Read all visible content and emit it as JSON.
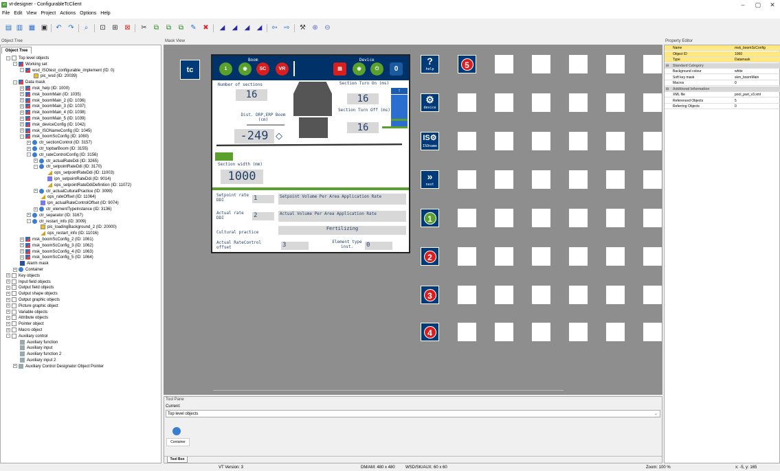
{
  "window": {
    "title": "vt-designer - ConfigurableTcClient",
    "min": "–",
    "max": "▢",
    "close": "✕"
  },
  "menu": [
    "File",
    "Edit",
    "View",
    "Project",
    "Actions",
    "Options",
    "Help"
  ],
  "panels": {
    "object_tree": "Object Tree",
    "object_tree_tab": "Object Tree",
    "mask_view": "Mask View",
    "property_editor": "Property Editor",
    "tool_pane": "Tool Pane",
    "tool_box_tab": "Tool Box"
  },
  "tree": [
    {
      "label": "Top level objects",
      "d": 0,
      "ic": "folder",
      "exp": "-"
    },
    {
      "label": "Working set",
      "d": 1,
      "ic": "mask",
      "exp": "-"
    },
    {
      "label": "wsd_ISOtest_configurable_implement (ID: 0)",
      "d": 2,
      "ic": "mask",
      "exp": "-"
    },
    {
      "label": "pic_wsd (ID: 20039)",
      "d": 3,
      "ic": "pic",
      "exp": ""
    },
    {
      "label": "Data mask",
      "d": 1,
      "ic": "mask",
      "exp": "-"
    },
    {
      "label": "msk_help (ID: 1000)",
      "d": 2,
      "ic": "mask",
      "exp": "+"
    },
    {
      "label": "msk_boomMain (ID: 1035)",
      "d": 2,
      "ic": "mask",
      "exp": "+"
    },
    {
      "label": "msk_boomMain_2 (ID: 1036)",
      "d": 2,
      "ic": "mask",
      "exp": "+"
    },
    {
      "label": "msk_boomMain_3 (ID: 1037)",
      "d": 2,
      "ic": "mask",
      "exp": "+"
    },
    {
      "label": "msk_boomMain_4 (ID: 1038)",
      "d": 2,
      "ic": "mask",
      "exp": "+"
    },
    {
      "label": "msk_boomMain_5 (ID: 1039)",
      "d": 2,
      "ic": "mask",
      "exp": "+"
    },
    {
      "label": "msk_deviceConfig (ID: 1042)",
      "d": 2,
      "ic": "mask",
      "exp": "+"
    },
    {
      "label": "msk_ISONameConfig (ID: 1045)",
      "d": 2,
      "ic": "mask",
      "exp": "+"
    },
    {
      "label": "msk_boomScConfig (ID: 1060)",
      "d": 2,
      "ic": "mask",
      "exp": "-"
    },
    {
      "label": "ctr_sectionControl (ID: 3157)",
      "d": 3,
      "ic": "ctr",
      "exp": "+"
    },
    {
      "label": "ctr_topbarBoom (ID: 3155)",
      "d": 3,
      "ic": "ctr",
      "exp": "+"
    },
    {
      "label": "ctr_rateControlConfig (ID: 3156)",
      "d": 3,
      "ic": "ctr",
      "exp": "-"
    },
    {
      "label": "ctr_actualRateDdi (ID: 3265)",
      "d": 4,
      "ic": "ctr",
      "exp": "+"
    },
    {
      "label": "ctr_setpointRateDdi (ID: 3170)",
      "d": 4,
      "ic": "ctr",
      "exp": "-"
    },
    {
      "label": "ops_setpointRateDdi (ID: 11003)",
      "d": 5,
      "ic": "ops",
      "exp": ""
    },
    {
      "label": "ipn_setpointRateDdi (ID: 9014)",
      "d": 5,
      "ic": "ipn",
      "exp": ""
    },
    {
      "label": "ops_setpointRateDdiDefinition (ID: 11072)",
      "d": 5,
      "ic": "ops",
      "exp": ""
    },
    {
      "label": "ctr_actualCulturalPractice (ID: 3099)",
      "d": 4,
      "ic": "ctr",
      "exp": "+"
    },
    {
      "label": "ops_rateOffset (ID: 11064)",
      "d": 4,
      "ic": "ops",
      "exp": ""
    },
    {
      "label": "ipn_actualRateControlOffset (ID: 9074)",
      "d": 4,
      "ic": "ipn",
      "exp": ""
    },
    {
      "label": "ctr_elementTypeInstance (ID: 3136)",
      "d": 4,
      "ic": "ctr",
      "exp": "+"
    },
    {
      "label": "ctr_separator (ID: 3167)",
      "d": 3,
      "ic": "ctr",
      "exp": "+"
    },
    {
      "label": "ctr_restart_info (ID: 3009)",
      "d": 3,
      "ic": "ctr",
      "exp": "-"
    },
    {
      "label": "pic_loadingBackground_2 (ID: 20000)",
      "d": 4,
      "ic": "pic",
      "exp": ""
    },
    {
      "label": "ops_restart_info (ID: 11016)",
      "d": 4,
      "ic": "ops",
      "exp": ""
    },
    {
      "label": "msk_boomScConfig_2 (ID: 1061)",
      "d": 2,
      "ic": "mask",
      "exp": "+"
    },
    {
      "label": "msk_boomScConfig_3 (ID: 1062)",
      "d": 2,
      "ic": "mask",
      "exp": "+"
    },
    {
      "label": "msk_boomScConfig_4 (ID: 1063)",
      "d": 2,
      "ic": "mask",
      "exp": "+"
    },
    {
      "label": "msk_boomScConfig_5 (ID: 1064)",
      "d": 2,
      "ic": "mask",
      "exp": "+"
    },
    {
      "label": "Alarm mask",
      "d": 1,
      "ic": "alarm",
      "exp": ""
    },
    {
      "label": "Container",
      "d": 1,
      "ic": "ctr",
      "exp": "+"
    },
    {
      "label": "Key objects",
      "d": 0,
      "ic": "folder",
      "exp": "+"
    },
    {
      "label": "Input field objects",
      "d": 0,
      "ic": "folder",
      "exp": "+"
    },
    {
      "label": "Output field objects",
      "d": 0,
      "ic": "folder",
      "exp": "+"
    },
    {
      "label": "Output shape objects",
      "d": 0,
      "ic": "folder",
      "exp": "+"
    },
    {
      "label": "Output graphic objects",
      "d": 0,
      "ic": "folder",
      "exp": "+"
    },
    {
      "label": "Picture graphic object",
      "d": 0,
      "ic": "folder",
      "exp": "+"
    },
    {
      "label": "Variable objects",
      "d": 0,
      "ic": "folder",
      "exp": "+"
    },
    {
      "label": "Attribute objects",
      "d": 0,
      "ic": "folder",
      "exp": "+"
    },
    {
      "label": "Pointer object",
      "d": 0,
      "ic": "folder",
      "exp": "+"
    },
    {
      "label": "Macro object",
      "d": 0,
      "ic": "folder",
      "exp": "+"
    },
    {
      "label": "Auxiliary control",
      "d": 0,
      "ic": "folder",
      "exp": "-"
    },
    {
      "label": "Auxiliary function",
      "d": 1,
      "ic": "aux",
      "exp": ""
    },
    {
      "label": "Auxiliary input",
      "d": 1,
      "ic": "aux",
      "exp": ""
    },
    {
      "label": "Auxiliary function 2",
      "d": 1,
      "ic": "aux",
      "exp": ""
    },
    {
      "label": "Auxiliary input 2",
      "d": 1,
      "ic": "aux",
      "exp": ""
    },
    {
      "label": "Auxiliary Control Designator Object Pointer",
      "d": 1,
      "ic": "aux",
      "exp": "+"
    }
  ],
  "vt": {
    "boom_label": "Boom",
    "device_label": "Device",
    "btn_sc": "SC",
    "btn_vr": "VR",
    "btn_zero": "0",
    "num_sections_label": "Number of sections",
    "num_sections": "16",
    "turn_on_label": "Section Turn On (ms)",
    "turn_on": "16",
    "turn_off_label": "Section Turn Off (ms)",
    "turn_off": "16",
    "dist_label": "Dist. DRP,ERP Boom (cm)",
    "dist": "-249",
    "width_label": "Section width (mm)",
    "width": "1000",
    "setpoint_label": "Setpoint rate DDI",
    "setpoint_val": "1",
    "setpoint_desc": "Setpoint Volume Per Area Application Rate",
    "actual_label": "Actual rate DDI",
    "actual_val": "2",
    "actual_desc": "Actual Volume Per Area Application Rate",
    "cultural_label": "Cultural practice",
    "cultural_val": "Fertilizing",
    "offset_label": "Actual RateControl offset",
    "offset_val": "3",
    "element_label": "Element type inst.",
    "element_val": "0",
    "tc_logo": "tc"
  },
  "softkeys": [
    {
      "label": "help",
      "glyph": "?"
    },
    {
      "label": "device",
      "glyph": "⚙"
    },
    {
      "label": "ISOname",
      "glyph": "IS⚙"
    },
    {
      "label": "next",
      "glyph": "»"
    }
  ],
  "numbered_keys": [
    "1",
    "2",
    "3",
    "4",
    "5"
  ],
  "properties": [
    {
      "k": "Name",
      "v": "msk_boomScConfig",
      "t": "hl"
    },
    {
      "k": "Object ID",
      "v": "1060",
      "t": "hl"
    },
    {
      "k": "Type",
      "v": "Datamask",
      "t": "hl"
    },
    {
      "k": "Standard Category",
      "v": "",
      "t": "cat"
    },
    {
      "k": "Background colour",
      "v": "white",
      "t": ""
    },
    {
      "k": "Soft key mask",
      "v": "skm_boomMain",
      "t": ""
    },
    {
      "k": "Macros",
      "v": "0",
      "t": ""
    },
    {
      "k": "Additional Information",
      "v": "",
      "t": "cat"
    },
    {
      "k": "XML file",
      "v": "pool_part_v3.xml",
      "t": ""
    },
    {
      "k": "Referenced Objects",
      "v": "5",
      "t": ""
    },
    {
      "k": "Referring Objects",
      "v": "0",
      "t": ""
    }
  ],
  "toolpane": {
    "current_label": "Current:",
    "current_value": "Top level objects",
    "container_btn": "Container"
  },
  "status": {
    "vt_version": "VT Version: 3",
    "dm": "DM/AM: 480 x 480",
    "wsd": "WSD/SK/AUX: 60 x 60",
    "zoom": "Zoom: 100 %",
    "coords": "x: -5, y: 165"
  },
  "colors": {
    "vt_blue": "#003a78",
    "green": "#5aa02c",
    "red": "#d81e1e",
    "selected": "#ffe880"
  }
}
